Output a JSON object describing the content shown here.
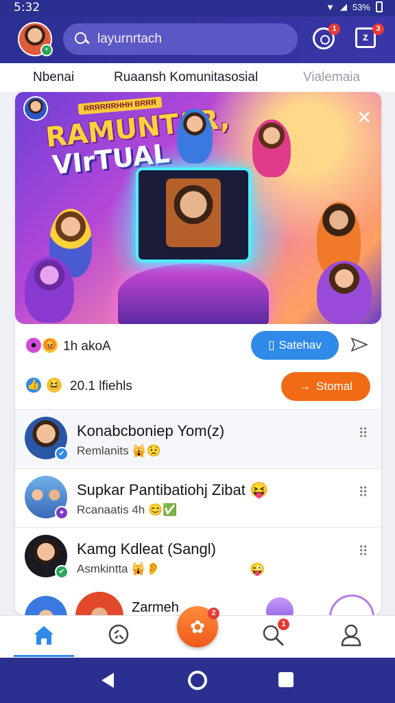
{
  "status_bar": {
    "time": "5:32",
    "battery": "53%"
  },
  "header": {
    "search_text": "layurnrtach",
    "notif_badge": "1",
    "chat_badge": "3",
    "chat_icon_glyph": "z"
  },
  "tabs": [
    {
      "label": "Nbenai"
    },
    {
      "label": "Ruaansh Komunitasosial"
    },
    {
      "label": "Vialemaia"
    }
  ],
  "post": {
    "banner_tag": "RRRRRRHHH BRRR",
    "banner_title_line1": "RAMUNTAR,",
    "banner_title_line2": "VIrTUAL",
    "reactions_text": "1h akoA",
    "primary_button": "Satehav",
    "likes_text": "20.1 lfiehls",
    "secondary_button": "Stomal"
  },
  "list": [
    {
      "name": "Konabcboniep Yom(z)",
      "subtitle": "Remlanits",
      "sub_emoji": "🙀😟",
      "right_emoji": "",
      "badge_color": "#2f8ae8",
      "badge_glyph": "✔"
    },
    {
      "name": "Supkar Pantibatiohj Zibat",
      "name_emoji": "😝",
      "subtitle": "Rcanaatis 4h",
      "sub_emoji": "😊✅",
      "right_emoji": "",
      "badge_color": "#7a3ac0",
      "badge_glyph": "✦"
    },
    {
      "name": "Kamg Kdleat (Sangl)",
      "subtitle": "Asmkintta",
      "sub_emoji": "🙀👂",
      "right_emoji": "😜",
      "badge_color": "#27a55a",
      "badge_glyph": "✔"
    }
  ],
  "partial_item": {
    "name": "Zarmeh"
  },
  "bottom_nav": {
    "fab_badge": "2",
    "search_badge": "1"
  },
  "colors": {
    "primary": "#2b2f8f",
    "accent_blue": "#2f8ae8",
    "accent_orange": "#f06b14"
  }
}
